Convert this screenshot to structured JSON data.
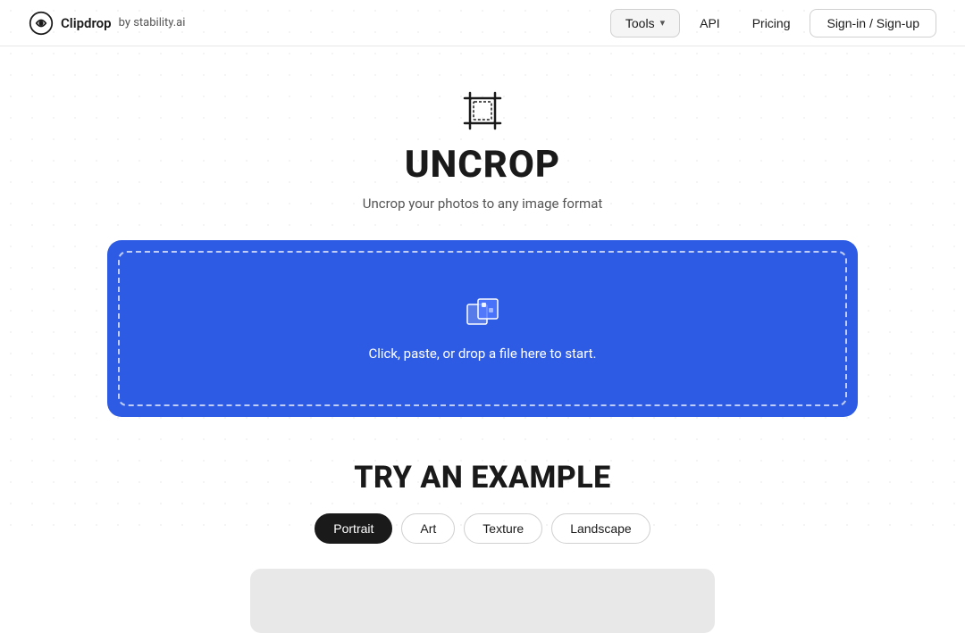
{
  "header": {
    "logo_text": "Clipdrop",
    "logo_by": "by stability.ai",
    "tools_label": "Tools",
    "api_label": "API",
    "pricing_label": "Pricing",
    "signin_label": "Sign-in / Sign-up"
  },
  "hero": {
    "title": "UNCROP",
    "subtitle": "Uncrop your photos to any image format",
    "drop_zone_text": "Click, paste, or drop a file here to start."
  },
  "examples": {
    "section_title": "TRY AN EXAMPLE",
    "filters": [
      {
        "label": "Portrait",
        "active": true
      },
      {
        "label": "Art",
        "active": false
      },
      {
        "label": "Texture",
        "active": false
      },
      {
        "label": "Landscape",
        "active": false
      }
    ]
  }
}
